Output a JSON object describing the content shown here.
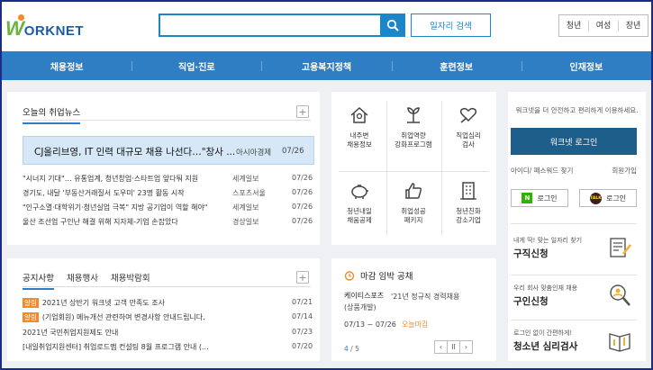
{
  "header": {
    "logo_mark": "W",
    "logo_text": "ORKNET",
    "search_placeholder": "",
    "job_search_label": "일자리 검색",
    "user_tabs": [
      "청년",
      "여성",
      "장년"
    ]
  },
  "nav": {
    "items": [
      "채용정보",
      "직업·진로",
      "고용복지정책",
      "훈련정보",
      "인재정보"
    ]
  },
  "news": {
    "title": "오늘의 취업뉴스",
    "more": "+",
    "headline": {
      "title": "CJ올리브영, IT 인력 대규모 채용 나선다…\"창사 ...",
      "source": "아시아경제",
      "date": "07/26"
    },
    "items": [
      {
        "title": "\"시너지 기대\"… 유통업계, 청년창업·스타트업 앞다퉈 지원",
        "source": "세계일보",
        "date": "07/26"
      },
      {
        "title": "경기도, 내달 '부동산거래질서 도우미' 23명 활동 시작",
        "source": "스포츠서울",
        "date": "07/26"
      },
      {
        "title": "\"인구소멸·대학위기·청년실업 극복\" 지방 공기업이 역할 해야\"",
        "source": "세계일보",
        "date": "07/26"
      },
      {
        "title": "울산 조선업 구인난 해결 위해 지자체-기업 손잡았다",
        "source": "경상일보",
        "date": "07/26"
      }
    ]
  },
  "notice": {
    "tabs": [
      "공지사항",
      "채용행사",
      "채용박람회"
    ],
    "more": "+",
    "items": [
      {
        "badge": "알림",
        "title": "2021년 상반기 워크넷 고객 만족도 조사",
        "date": "07/21"
      },
      {
        "badge": "알림",
        "title": "(기업회원) 메뉴개선 관련하여 변경사항 안내드립니다.",
        "date": "07/14"
      },
      {
        "badge": "",
        "title": "2021년 국민취업지원제도 안내",
        "date": "07/23"
      },
      {
        "badge": "",
        "title": "[내일취업지원센터] 취업로드맵 컨설팅 8월 프로그램 안내 (...",
        "date": "07/20"
      }
    ]
  },
  "services": {
    "items": [
      {
        "icon": "house-map-icon",
        "label1": "내주변",
        "label2": "채용정보"
      },
      {
        "icon": "sprout-icon",
        "label1": "취업역량",
        "label2": "강화프로그램"
      },
      {
        "icon": "heart-hand-icon",
        "label1": "직업심리",
        "label2": "검사"
      },
      {
        "icon": "piggy-bank-icon",
        "label1": "청년내일",
        "label2": "채움공제"
      },
      {
        "icon": "thumbs-up-icon",
        "label1": "취업성공",
        "label2": "패키지"
      },
      {
        "icon": "building-icon",
        "label1": "청년친화",
        "label2": "강소기업"
      }
    ]
  },
  "deadline": {
    "title": "마감 임박 공채",
    "company": "케이티스포츠",
    "desc": "'21년 정규직 경력채용",
    "desc2": "(상품개발)",
    "date": "07/13 ~ 07/26",
    "date_tag": "오늘마감",
    "page_current": "4",
    "page_total": "/ 5",
    "ctrl_prev": "‹",
    "ctrl_pause": "II",
    "ctrl_next": "›"
  },
  "login": {
    "desc": "워크넷을 더 안전하고 편리하게 이용하세요.",
    "login_button": "워크넷 로그인",
    "find_link": "아이디/ 패스워드 찾기",
    "join_link": "회원가입",
    "naver_mark": "N",
    "naver_label": "로그인",
    "kakao_mark": "TALK",
    "kakao_label": "로그인",
    "promos": [
      {
        "sub": "내게 딱! 맞는 일자리 찾기",
        "main": "구직신청",
        "icon": "form-pen-icon"
      },
      {
        "sub": "우리 회사 맞춤인재 채용",
        "main": "구인신청",
        "icon": "search-person-icon"
      },
      {
        "sub": "로그인 없이 간편하게!",
        "main": "청소년 심리검사",
        "icon": "book-chart-icon"
      }
    ]
  },
  "colors": {
    "brand_blue": "#2f7ec4",
    "search_blue": "#1c86c8",
    "login_blue": "#1e5e8a",
    "accent_orange": "#f08a2a",
    "logo_green": "#6bb43f"
  }
}
